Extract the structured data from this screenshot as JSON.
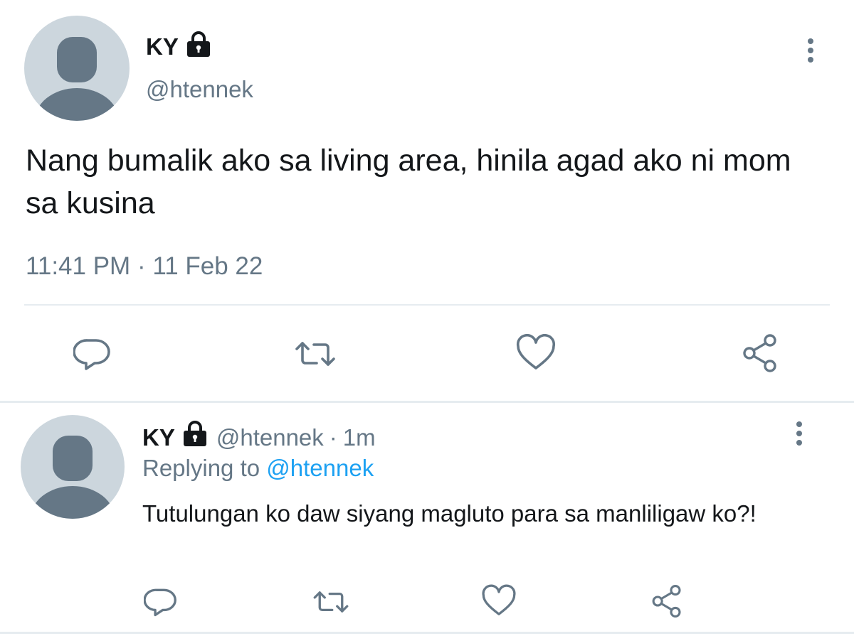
{
  "main_tweet": {
    "author_name": "KY",
    "handle": "@htennek",
    "text": "Nang bumalik ako sa living area, hinila  agad ako ni mom sa kusina",
    "time": "11:41 PM",
    "separator": "·",
    "date": "11 Feb 22"
  },
  "reply_tweet": {
    "author_name": "KY",
    "handle": "@htennek",
    "separator": "·",
    "time_ago": "1m",
    "replying_prefix": "Replying to",
    "replying_to": "@htennek",
    "text": "Tutulungan ko daw siyang magluto para sa manliligaw ko?!"
  },
  "icons": {
    "lock": "lock-icon",
    "more": "more-vertical-icon",
    "reply": "reply-icon",
    "retweet": "retweet-icon",
    "like": "heart-icon",
    "share": "share-icon"
  },
  "colors": {
    "text_primary": "#14171a",
    "text_secondary": "#657786",
    "accent": "#1da1f2",
    "avatar_bg": "#ccd6dd",
    "avatar_fg": "#657786",
    "divider": "#e6ecf0"
  }
}
